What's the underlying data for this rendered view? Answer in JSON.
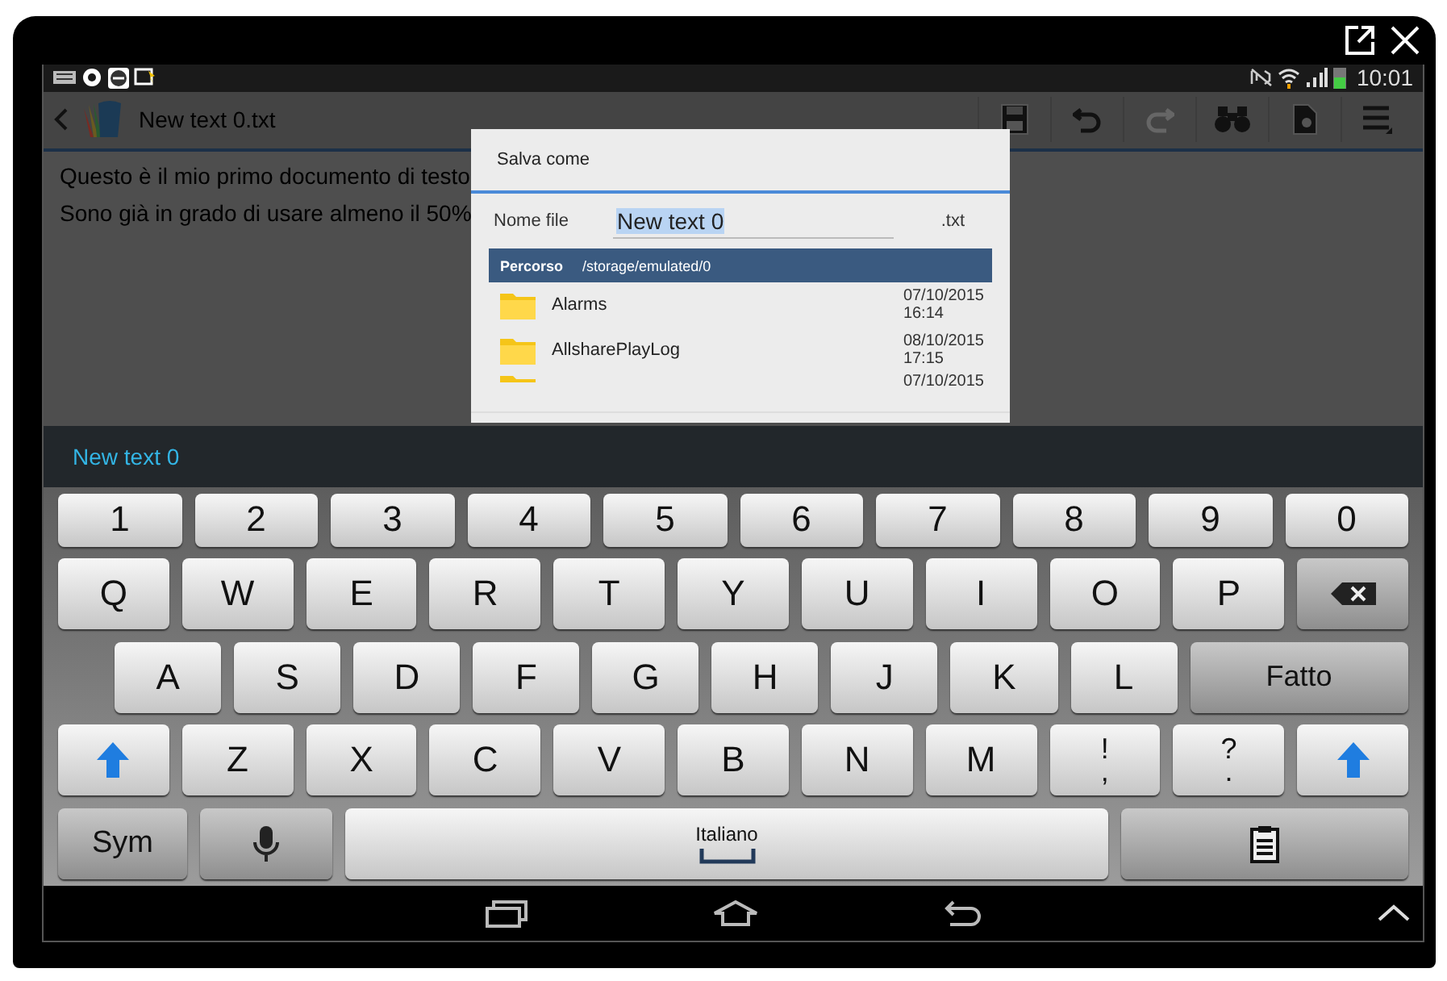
{
  "status_bar": {
    "time": "10:01"
  },
  "action_bar": {
    "title": "New text 0.txt",
    "tools": [
      {
        "kind": "save",
        "disabled": false
      },
      {
        "kind": "undo",
        "disabled": false
      },
      {
        "kind": "redo",
        "disabled": true
      },
      {
        "kind": "find",
        "disabled": false
      },
      {
        "kind": "doc",
        "disabled": false
      },
      {
        "kind": "menu",
        "disabled": false
      }
    ]
  },
  "editor": {
    "lines": [
      "Questo è il mio primo documento di testo",
      "Sono già in grado di usare almeno il 50%"
    ]
  },
  "dialog": {
    "title": "Salva come",
    "name_label": "Nome file",
    "name_value": "New text 0",
    "extension": ".txt",
    "path_label": "Percorso",
    "path": "/storage/emulated/0",
    "files": [
      {
        "name": "Alarms",
        "date": "07/10/2015",
        "time": "16:14"
      },
      {
        "name": "AllsharePlayLog",
        "date": "08/10/2015",
        "time": "17:15"
      },
      {
        "date": "07/10/2015"
      }
    ]
  },
  "input_preview": "New text 0",
  "keyboard": {
    "rows": [
      [
        {
          "kind": "num",
          "label": "1"
        },
        {
          "kind": "num",
          "label": "2"
        },
        {
          "kind": "num",
          "label": "3"
        },
        {
          "kind": "num",
          "label": "4"
        },
        {
          "kind": "num",
          "label": "5"
        },
        {
          "kind": "num",
          "label": "6"
        },
        {
          "kind": "num",
          "label": "7"
        },
        {
          "kind": "num",
          "label": "8"
        },
        {
          "kind": "num",
          "label": "9"
        },
        {
          "kind": "num",
          "label": "0"
        }
      ],
      [
        {
          "kind": "char",
          "label": "Q"
        },
        {
          "kind": "char",
          "label": "W"
        },
        {
          "kind": "char",
          "label": "E"
        },
        {
          "kind": "char",
          "label": "R"
        },
        {
          "kind": "char",
          "label": "T"
        },
        {
          "kind": "char",
          "label": "Y"
        },
        {
          "kind": "char",
          "label": "U"
        },
        {
          "kind": "char",
          "label": "I"
        },
        {
          "kind": "char",
          "label": "O"
        },
        {
          "kind": "char",
          "label": "P"
        },
        {
          "kind": "backspace"
        }
      ],
      [
        {
          "kind": "char",
          "label": "A"
        },
        {
          "kind": "char",
          "label": "S"
        },
        {
          "kind": "char",
          "label": "D"
        },
        {
          "kind": "char",
          "label": "F"
        },
        {
          "kind": "char",
          "label": "G"
        },
        {
          "kind": "char",
          "label": "H"
        },
        {
          "kind": "char",
          "label": "J"
        },
        {
          "kind": "char",
          "label": "K"
        },
        {
          "kind": "char",
          "label": "L"
        },
        {
          "kind": "action",
          "label": "Fatto"
        }
      ],
      [
        {
          "kind": "shift"
        },
        {
          "kind": "char",
          "label": "Z"
        },
        {
          "kind": "char",
          "label": "X"
        },
        {
          "kind": "char",
          "label": "C"
        },
        {
          "kind": "char",
          "label": "V"
        },
        {
          "kind": "char",
          "label": "B"
        },
        {
          "kind": "char",
          "label": "N"
        },
        {
          "kind": "char",
          "label": "M"
        },
        {
          "kind": "punct",
          "label": "!",
          "sub": ","
        },
        {
          "kind": "punct",
          "label": "?",
          "sub": "."
        },
        {
          "kind": "shift"
        }
      ],
      [
        {
          "kind": "sym",
          "label": "Sym"
        },
        {
          "kind": "mic"
        },
        {
          "kind": "space",
          "label": "Italiano"
        },
        {
          "kind": "clipboard"
        }
      ]
    ]
  }
}
